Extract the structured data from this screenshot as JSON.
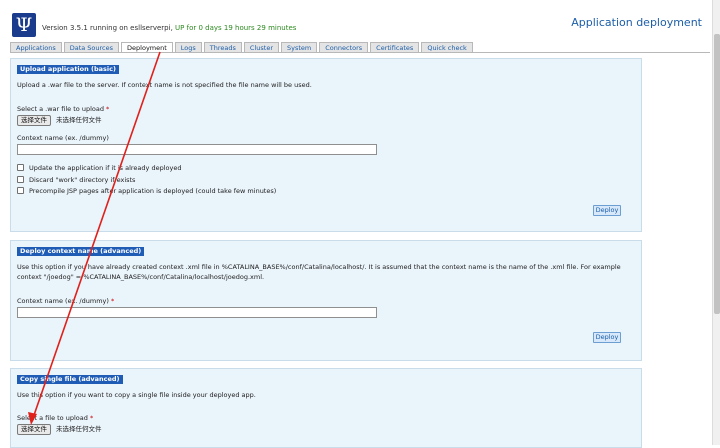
{
  "header": {
    "logo_glyph": "Ψ",
    "version_text": "Version 3.5.1 running on esllserverpi,",
    "uptime_text": "UP for 0 days 19 hours 29 minutes",
    "page_title": "Application deployment"
  },
  "tabs": [
    {
      "label": "Applications",
      "active": false
    },
    {
      "label": "Data Sources",
      "active": false
    },
    {
      "label": "Deployment",
      "active": true
    },
    {
      "label": "Logs",
      "active": false
    },
    {
      "label": "Threads",
      "active": false
    },
    {
      "label": "Cluster",
      "active": false
    },
    {
      "label": "System",
      "active": false
    },
    {
      "label": "Connectors",
      "active": false
    },
    {
      "label": "Certificates",
      "active": false
    },
    {
      "label": "Quick check",
      "active": false
    }
  ],
  "upload_basic": {
    "title": "Upload application (basic)",
    "description": "Upload a .war file to the server. If context name is not specified the file name will be used.",
    "war_label": "Select a .war file to upload",
    "required_mark": "*",
    "file_button": "选择文件",
    "no_file_text": "未选择任何文件",
    "context_label": "Context name (ex. /dummy)",
    "context_value": "",
    "options": [
      {
        "label": "Update the application if it is already deployed",
        "checked": false
      },
      {
        "label": "Discard \"work\" directory if exists",
        "checked": false
      },
      {
        "label": "Precompile JSP pages after application is deployed (could take few minutes)",
        "checked": false
      }
    ],
    "deploy_button": "Deploy"
  },
  "deploy_context": {
    "title": "Deploy context name (advanced)",
    "description": "Use this option if you have already created context .xml file in %CATALINA_BASE%/conf/Catalina/localhost/. It is assumed that the context name is the name of the .xml file. For example context \"/joedog\" = %CATALINA_BASE%/conf/Catalina/localhost/joedog.xml.",
    "context_label": "Context name (ex. /dummy)",
    "required_mark": "*",
    "context_value": "",
    "deploy_button": "Deploy"
  },
  "copy_file": {
    "title": "Copy single file (advanced)",
    "description": "Use this option if you want to copy a single file inside your deployed app.",
    "file_label": "Select a file to upload",
    "required_mark": "*",
    "file_button": "选择文件",
    "no_file_text": "未选择任何文件"
  },
  "colors": {
    "accent": "#1c5ea8",
    "panel_bg": "#eaf4fb",
    "section_title_bg": "#1f5cb6",
    "uptime_green": "#2c8a1f",
    "annotation_red": "#e0201b"
  }
}
